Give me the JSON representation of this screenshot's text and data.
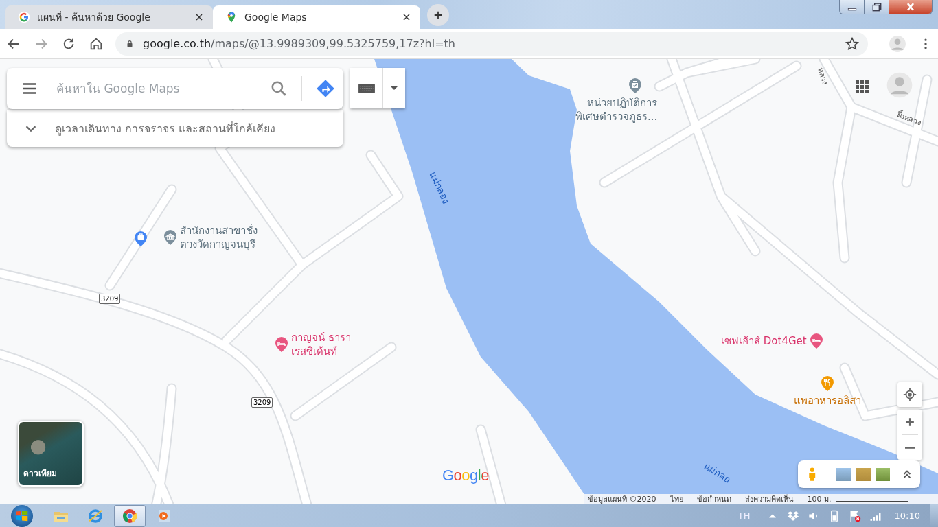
{
  "browser": {
    "tabs": [
      {
        "title": "แผนที่ - ค้นหาด้วย Google",
        "kind": "search",
        "selected": false
      },
      {
        "title": "Google Maps",
        "kind": "maps",
        "selected": true
      }
    ],
    "address": {
      "host": "google.co.th",
      "path": "/maps/@13.9989309,99.5325759,17z?hl=th"
    }
  },
  "maps": {
    "search": {
      "placeholder": "ค้นหาใน Google Maps"
    },
    "explore": "ดูเวลาเดินทาง การจราจร และสถานที่ใกล้เคียง",
    "labels": [
      {
        "kind": "river",
        "text": "แม่กลอง"
      },
      {
        "kind": "river",
        "text": "แม่กลอ"
      },
      {
        "kind": "road",
        "text": "หลวง"
      },
      {
        "kind": "road",
        "text": "ผึ้งหลวง"
      },
      {
        "kind": "shield",
        "text": "3209"
      },
      {
        "kind": "shield",
        "text": "3209"
      },
      {
        "kind": "office",
        "text": "สำนักงานสาขาชั่ง\nตวงวัดกาญจนบุรี"
      },
      {
        "kind": "police",
        "text": "หน่วยปฏิบัติการ\nพิเศษตำรวจภูธร..."
      },
      {
        "kind": "hotel",
        "text": "กาญจน์ ธารา\nเรสซิเด้นท์"
      },
      {
        "kind": "hotel",
        "text": "เซฟเฮ้าส์ Dot4Get"
      },
      {
        "kind": "restaurant",
        "text": "แพอาหารอลิสา"
      }
    ],
    "layer_button": "ดาวเทียม",
    "logo": "Google",
    "footer": [
      "ข้อมูลแผนที่ ©2020",
      "ไทย",
      "ข้อกำหนด",
      "ส่งความคิดเห็น"
    ],
    "scale": "100 ม."
  },
  "taskbar": {
    "apps": [
      {
        "kind": "folder",
        "selected": false
      },
      {
        "kind": "ie",
        "selected": false
      },
      {
        "kind": "chrome",
        "selected": true
      },
      {
        "kind": "media",
        "selected": false
      }
    ],
    "language": "TH",
    "clock": "10:10"
  }
}
